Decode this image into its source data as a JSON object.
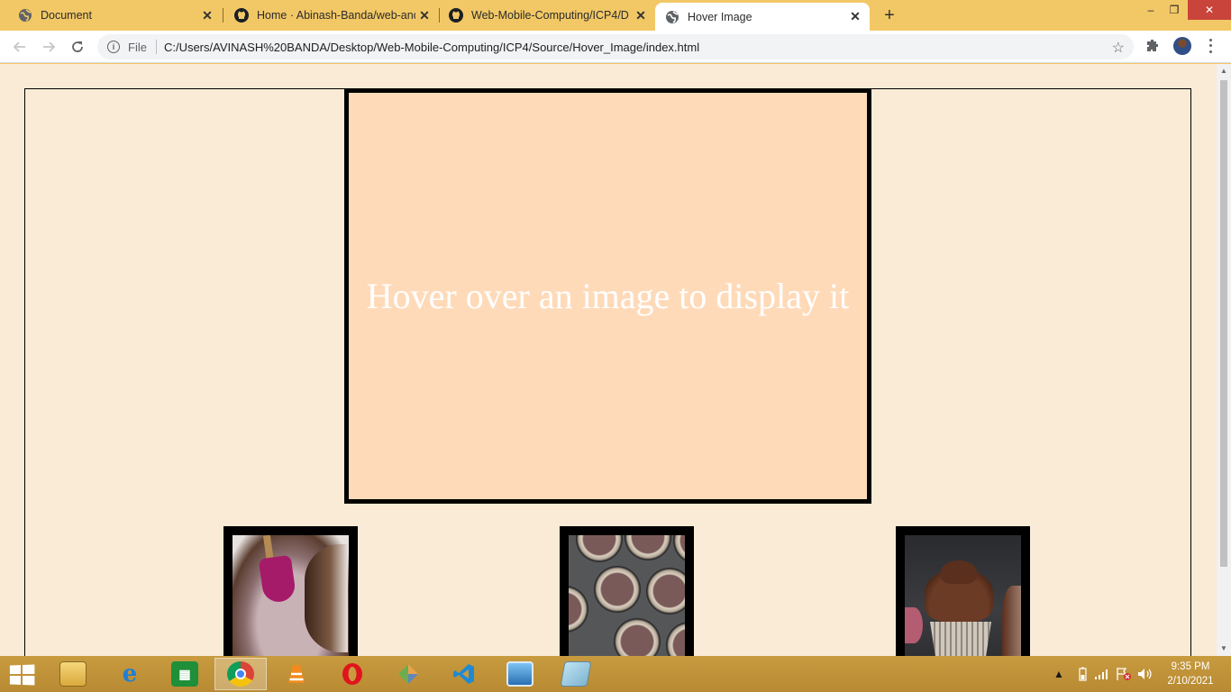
{
  "browser": {
    "tabs": [
      {
        "title": "Document",
        "icon": "globe-icon",
        "active": false
      },
      {
        "title": "Home · Abinash-Banda/web-and",
        "icon": "github-icon",
        "active": false
      },
      {
        "title": "Web-Mobile-Computing/ICP4/D",
        "icon": "github-icon",
        "active": false
      },
      {
        "title": "Hover Image",
        "icon": "globe-icon",
        "active": true
      }
    ],
    "new_tab_glyph": "+",
    "close_glyph": "✕",
    "window_controls": {
      "minimize": "–",
      "restore": "❐",
      "close": "✕"
    },
    "address": {
      "scheme_label": "File",
      "url": "C:/Users/AVINASH%20BANDA/Desktop/Web-Mobile-Computing/ICP4/Source/Hover_Image/index.html"
    }
  },
  "page": {
    "preview_text": "Hover over an image to display it",
    "background_color": "#faebd7",
    "preview_color": "#ffdab9",
    "thumbnails": [
      {
        "subject": "batter-bowl-image"
      },
      {
        "subject": "cupcake-pan-image"
      },
      {
        "subject": "chocolate-cupcake-image"
      }
    ]
  },
  "taskbar": {
    "apps": [
      {
        "name": "file-explorer-icon",
        "active": false
      },
      {
        "name": "internet-explorer-icon",
        "active": false
      },
      {
        "name": "store-icon",
        "active": false
      },
      {
        "name": "chrome-icon",
        "active": true
      },
      {
        "name": "vlc-icon",
        "active": false
      },
      {
        "name": "opera-icon",
        "active": false
      },
      {
        "name": "app-icon",
        "active": false
      },
      {
        "name": "vscode-icon",
        "active": false
      },
      {
        "name": "photos-icon",
        "active": false
      },
      {
        "name": "notepad-icon",
        "active": false
      }
    ],
    "time": "9:35 PM",
    "date": "2/10/2021"
  }
}
